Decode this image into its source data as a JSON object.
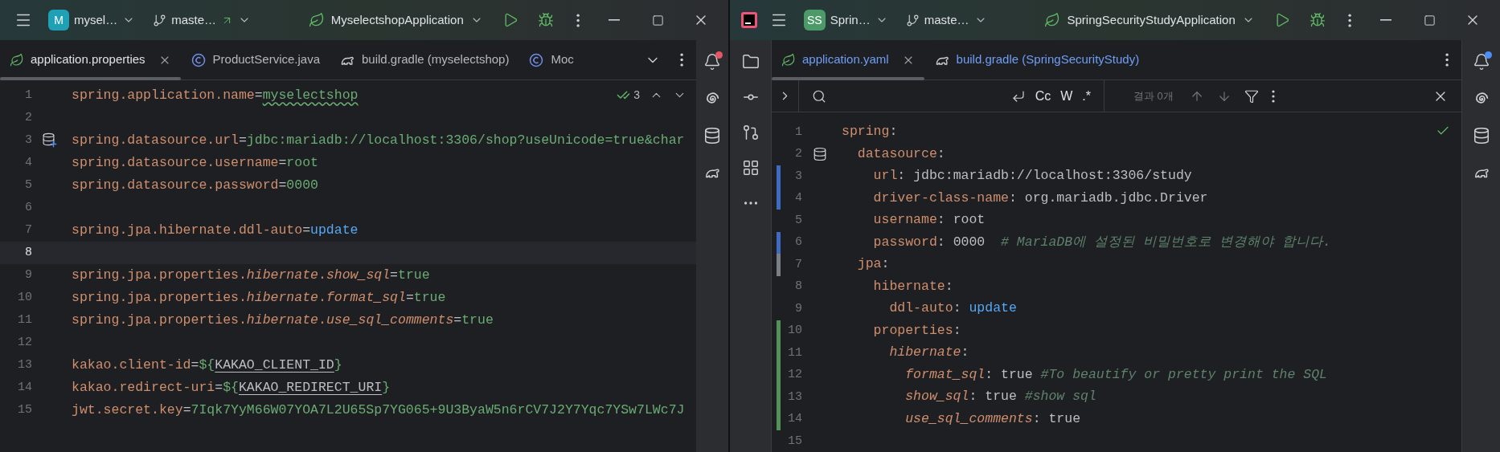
{
  "left_window": {
    "title_bar": {
      "project_badge": "M",
      "project": "mysel…",
      "branch": "maste…",
      "outgoing": true,
      "run_config": "MyselectshopApplication"
    },
    "tabs": [
      {
        "label": "application.properties",
        "kind": "spring",
        "selected": true,
        "closable": true,
        "vcs_modified": false
      },
      {
        "label": "ProductService.java",
        "kind": "class",
        "selected": false,
        "closable": false,
        "vcs_modified": false
      },
      {
        "label": "build.gradle (myselectshop)",
        "kind": "gradle",
        "selected": false,
        "closable": false,
        "vcs_modified": false
      },
      {
        "label": "Moc",
        "kind": "class",
        "selected": false,
        "closable": false,
        "vcs_modified": false
      }
    ],
    "inspection": {
      "count": "3"
    },
    "lines": [
      {
        "number": "1",
        "current": false,
        "tokens": [
          {
            "kind": "key",
            "text": "spring.application.name"
          },
          {
            "kind": "punct",
            "text": "="
          },
          {
            "kind": "typo",
            "text": "myselectshop"
          }
        ]
      },
      {
        "number": "2",
        "current": false
      },
      {
        "number": "3",
        "current": false,
        "kind": "db-plus",
        "tokens": [
          {
            "kind": "key",
            "text": "spring.datasource.url"
          },
          {
            "kind": "punct",
            "text": "="
          },
          {
            "kind": "value",
            "text": "jdbc:mariadb://localhost:3306/shop?useUnicode=true&char"
          }
        ]
      },
      {
        "number": "4",
        "current": false,
        "tokens": [
          {
            "kind": "key",
            "text": "spring.datasource.username"
          },
          {
            "kind": "punct",
            "text": "="
          },
          {
            "kind": "value",
            "text": "root"
          }
        ]
      },
      {
        "number": "5",
        "current": false,
        "tokens": [
          {
            "kind": "key",
            "text": "spring.datasource.password"
          },
          {
            "kind": "punct",
            "text": "="
          },
          {
            "kind": "value",
            "text": "0000"
          }
        ]
      },
      {
        "number": "6",
        "current": false
      },
      {
        "number": "7",
        "current": false,
        "tokens": [
          {
            "kind": "key",
            "text": "spring.jpa.hibernate.ddl-auto"
          },
          {
            "kind": "punct",
            "text": "="
          },
          {
            "kind": "keyword",
            "text": "update"
          }
        ]
      },
      {
        "number": "8",
        "current": true
      },
      {
        "number": "9",
        "current": false,
        "tokens": [
          {
            "kind": "key",
            "text": "spring.jpa.properties."
          },
          {
            "kind": "italic",
            "text": "hibernate"
          },
          {
            "kind": "key",
            "text": "."
          },
          {
            "kind": "italic",
            "text": "show_sql"
          },
          {
            "kind": "punct",
            "text": "="
          },
          {
            "kind": "value",
            "text": "true"
          }
        ]
      },
      {
        "number": "10",
        "current": false,
        "tokens": [
          {
            "kind": "key",
            "text": "spring.jpa.properties."
          },
          {
            "kind": "italic",
            "text": "hibernate"
          },
          {
            "kind": "key",
            "text": "."
          },
          {
            "kind": "italic",
            "text": "format_sql"
          },
          {
            "kind": "punct",
            "text": "="
          },
          {
            "kind": "value",
            "text": "true"
          }
        ]
      },
      {
        "number": "11",
        "current": false,
        "tokens": [
          {
            "kind": "key",
            "text": "spring.jpa.properties."
          },
          {
            "kind": "italic",
            "text": "hibernate"
          },
          {
            "kind": "key",
            "text": "."
          },
          {
            "kind": "italic",
            "text": "use_sql_comments"
          },
          {
            "kind": "punct",
            "text": "="
          },
          {
            "kind": "value",
            "text": "true"
          }
        ]
      },
      {
        "number": "12",
        "current": false
      },
      {
        "number": "13",
        "current": false,
        "tokens": [
          {
            "kind": "key",
            "text": "kakao.client-id"
          },
          {
            "kind": "punct",
            "text": "="
          },
          {
            "kind": "value",
            "text": "${"
          },
          {
            "kind": "env",
            "text": "KAKAO_CLIENT_ID"
          },
          {
            "kind": "value",
            "text": "}"
          }
        ]
      },
      {
        "number": "14",
        "current": false,
        "tokens": [
          {
            "kind": "key",
            "text": "kakao.redirect-uri"
          },
          {
            "kind": "punct",
            "text": "="
          },
          {
            "kind": "value",
            "text": "${"
          },
          {
            "kind": "env",
            "text": "KAKAO_REDIRECT_URI"
          },
          {
            "kind": "value",
            "text": "}"
          }
        ]
      },
      {
        "number": "15",
        "current": false,
        "tokens": [
          {
            "kind": "key",
            "text": "jwt.secret.key"
          },
          {
            "kind": "punct",
            "text": "="
          },
          {
            "kind": "value",
            "text": "7Iqk7YyM66W07YOA7L2U65Sp7YG065+9U3ByaW5n6rCV7J2Y7Yqc7YSw7LWc7J"
          }
        ]
      }
    ]
  },
  "right_window": {
    "title_bar": {
      "project_badge": "SS",
      "project": "Sprin…",
      "branch": "maste…",
      "outgoing": false,
      "run_config": "SpringSecurityStudyApplication"
    },
    "tabs": [
      {
        "label": "application.yaml",
        "kind": "spring",
        "selected": true,
        "closable": true,
        "vcs_modified": true
      },
      {
        "label": "build.gradle (SpringSecurityStudy)",
        "kind": "gradle",
        "selected": false,
        "closable": false,
        "vcs_modified": true
      }
    ],
    "find_bar": {
      "options": [
        "Cc",
        "W",
        ".*"
      ],
      "result": "결과 0개"
    },
    "lines": [
      {
        "number": "1",
        "tokens": [
          {
            "kind": "key",
            "text": "spring"
          },
          {
            "kind": "punct",
            "text": ":"
          }
        ]
      },
      {
        "number": "2",
        "kind": "db",
        "tokens": [
          {
            "kind": "key",
            "text": "  datasource"
          },
          {
            "kind": "punct",
            "text": ":"
          }
        ]
      },
      {
        "number": "3",
        "color": "#3f6ac2",
        "tokens": [
          {
            "kind": "key",
            "text": "    url"
          },
          {
            "kind": "punct",
            "text": ": "
          },
          {
            "kind": "plain",
            "text": "jdbc:mariadb://localhost:3306/study"
          }
        ]
      },
      {
        "number": "4",
        "color": "#3f6ac2",
        "tokens": [
          {
            "kind": "key",
            "text": "    driver-class-name"
          },
          {
            "kind": "punct",
            "text": ": "
          },
          {
            "kind": "plain",
            "text": "org.mariadb.jdbc.Driver"
          }
        ]
      },
      {
        "number": "5",
        "tokens": [
          {
            "kind": "key",
            "text": "    username"
          },
          {
            "kind": "punct",
            "text": ": "
          },
          {
            "kind": "plain",
            "text": "root"
          }
        ]
      },
      {
        "number": "6",
        "color": "#3f6ac2",
        "tokens": [
          {
            "kind": "key",
            "text": "    password"
          },
          {
            "kind": "punct",
            "text": ": "
          },
          {
            "kind": "plain",
            "text": "0000  "
          },
          {
            "kind": "comment",
            "text": "# MariaDB에 설정된 비밀번호로 변경해야 합니다."
          }
        ]
      },
      {
        "number": "7",
        "color": "#7a7e85",
        "tokens": [
          {
            "kind": "key",
            "text": "  jpa"
          },
          {
            "kind": "punct",
            "text": ":"
          }
        ]
      },
      {
        "number": "8",
        "tokens": [
          {
            "kind": "key",
            "text": "    hibernate"
          },
          {
            "kind": "punct",
            "text": ":"
          }
        ]
      },
      {
        "number": "9",
        "tokens": [
          {
            "kind": "key",
            "text": "      ddl-auto"
          },
          {
            "kind": "punct",
            "text": ": "
          },
          {
            "kind": "keyword",
            "text": "update"
          }
        ]
      },
      {
        "number": "10",
        "color": "#549159",
        "tokens": [
          {
            "kind": "key",
            "text": "    properties"
          },
          {
            "kind": "punct",
            "text": ":"
          }
        ]
      },
      {
        "number": "11",
        "color": "#549159",
        "tokens": [
          {
            "kind": "italic",
            "text": "      hibernate"
          },
          {
            "kind": "punct",
            "text": ":"
          }
        ]
      },
      {
        "number": "12",
        "color": "#549159",
        "tokens": [
          {
            "kind": "italic",
            "text": "        format_sql"
          },
          {
            "kind": "punct",
            "text": ": "
          },
          {
            "kind": "plain",
            "text": "true "
          },
          {
            "kind": "comment",
            "text": "#To beautify or pretty print the SQL"
          }
        ]
      },
      {
        "number": "13",
        "color": "#549159",
        "tokens": [
          {
            "kind": "italic",
            "text": "        show_sql"
          },
          {
            "kind": "punct",
            "text": ": "
          },
          {
            "kind": "plain",
            "text": "true "
          },
          {
            "kind": "comment",
            "text": "#show sql"
          }
        ]
      },
      {
        "number": "14",
        "color": "#549159",
        "tokens": [
          {
            "kind": "italic",
            "text": "        use_sql_comments"
          },
          {
            "kind": "punct",
            "text": ": "
          },
          {
            "kind": "plain",
            "text": "true"
          }
        ]
      },
      {
        "number": "15"
      }
    ]
  }
}
